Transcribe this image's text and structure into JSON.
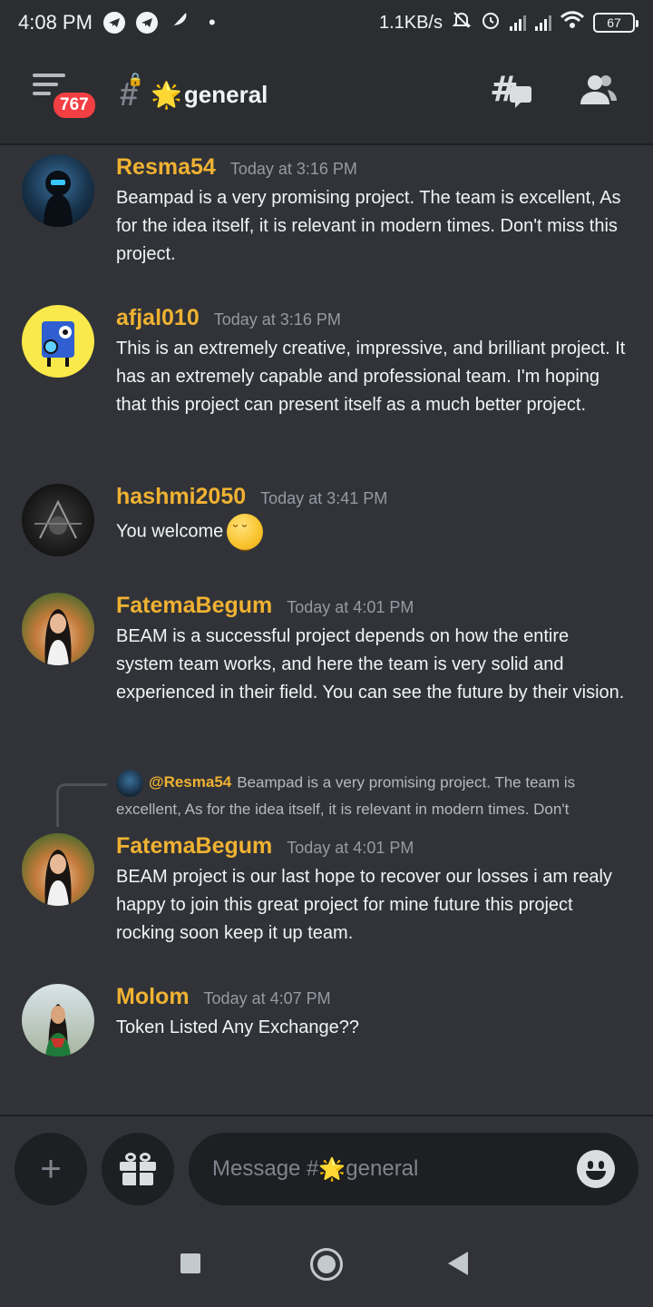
{
  "status_bar": {
    "time": "4:08 PM",
    "network_speed": "1.1KB/s",
    "battery": "67",
    "icons": [
      "telegram-icon",
      "telegram-icon",
      "feather-icon",
      "dot-icon",
      "mute-bell-icon",
      "alarm-icon",
      "signal-icon",
      "signal-icon",
      "wifi-icon",
      "battery-icon"
    ]
  },
  "header": {
    "unread_badge": "767",
    "channel_name": "general",
    "channel_emoji": "🌟",
    "icons": [
      "menu-icon",
      "locked-channel-icon",
      "threads-icon",
      "members-icon"
    ]
  },
  "messages": [
    {
      "username": "Resma54",
      "timestamp": "Today at 3:16 PM",
      "text": "Beampad is a very promising project. The team is excellent, As for the idea itself, it is relevant in modern times. Don't miss this project."
    },
    {
      "username": "afjal010",
      "timestamp": "Today at 3:16 PM",
      "text": "This is an extremely creative, impressive, and brilliant project. It has an extremely capable and professional team. I'm hoping that this project can present itself as a much better project."
    },
    {
      "username": "hashmi2050",
      "timestamp": "Today at 3:41 PM",
      "text": "You welcome"
    },
    {
      "username": "FatemaBegum",
      "timestamp": "Today at 4:01 PM",
      "text": "BEAM is a successful project depends on how the entire system team works, and here the team is very solid and experienced in their field. You can see the future by their vision."
    },
    {
      "reply_to": {
        "username": "@Resma54",
        "text": "Beampad is a very promising project. The team is excellent, As for the idea itself, it is relevant in modern times. Don't"
      },
      "username": "FatemaBegum",
      "timestamp": "Today at 4:01 PM",
      "text": "BEAM project is our last hope to recover our losses i am realy happy to join this great project for mine future this project rocking soon keep it up team."
    },
    {
      "username": "Molom",
      "timestamp": "Today at 4:07 PM",
      "text": "Token Listed Any Exchange??"
    }
  ],
  "composer": {
    "placeholder_prefix": "Message #",
    "placeholder_emoji": "🌟",
    "placeholder_channel": "general"
  },
  "colors": {
    "background": "#313338",
    "header": "#2b2d31",
    "username": "#f0b232",
    "badge": "#f23f43"
  }
}
